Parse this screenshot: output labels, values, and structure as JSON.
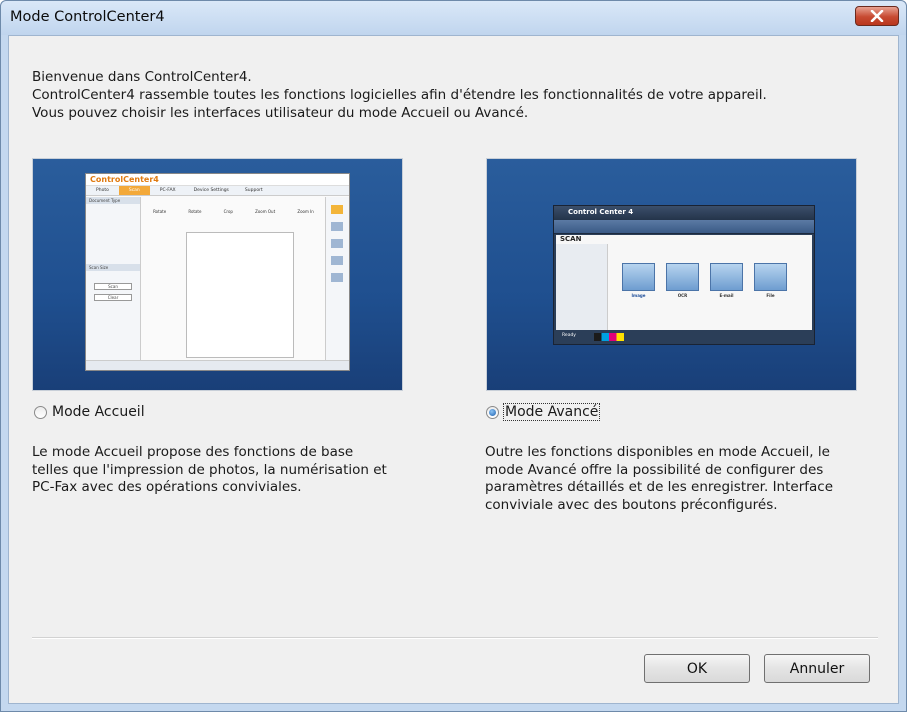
{
  "window": {
    "title": "Mode ControlCenter4"
  },
  "intro": {
    "line1": "Bienvenue dans ControlCenter4.",
    "line2": "ControlCenter4 rassemble toutes les fonctions logicielles afin d'étendre les fonctionnalités de votre appareil.",
    "line3": "Vous pouvez choisir les interfaces utilisateur du mode Accueil ou Avancé."
  },
  "home_mode": {
    "preview_logo": "ControlCenter4",
    "preview_tabs": [
      "Photo",
      "Scan",
      "PC-FAX",
      "Device Settings",
      "Support"
    ],
    "preview_tools": [
      "Rotate",
      "Rotate",
      "Crop",
      "Zoom Out",
      "Zoom In"
    ],
    "preview_sidebar": [
      "Document Type",
      "Scan Size",
      "Scan",
      "Clear"
    ],
    "label": "Mode Accueil",
    "selected": false,
    "desc_line1": "Le mode Accueil propose des fonctions de base",
    "desc_line2": "telles que l'impression de photos, la numérisation et",
    "desc_line3": "PC-Fax avec des opérations conviviales."
  },
  "advanced_mode": {
    "preview_logo": "Control Center 4",
    "preview_section": "SCAN",
    "preview_buttons": [
      "Image",
      "OCR",
      "E-mail",
      "File"
    ],
    "preview_status": "Ready",
    "label": "Mode Avancé",
    "selected": true,
    "desc_line1": "Outre les fonctions disponibles en mode Accueil, le",
    "desc_line2": "mode Avancé offre la possibilité de configurer des",
    "desc_line3": "paramètres détaillés et de les enregistrer. Interface",
    "desc_line4": "conviviale avec des boutons préconfigurés."
  },
  "buttons": {
    "ok": "OK",
    "cancel": "Annuler"
  }
}
